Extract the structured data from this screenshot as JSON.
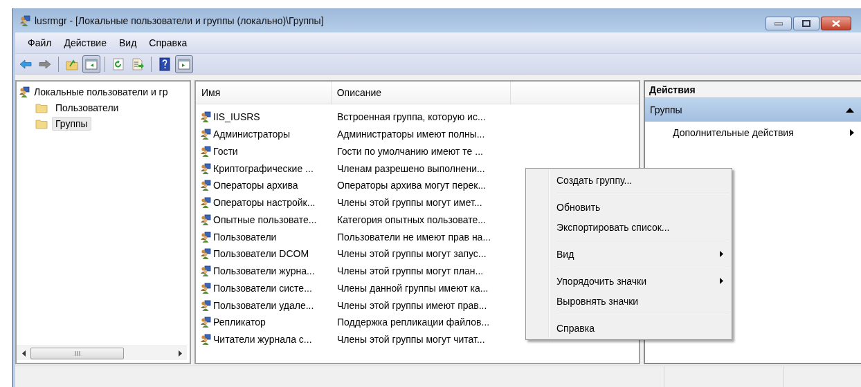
{
  "window": {
    "title": "lusrmgr - [Локальные пользователи и группы (локально)\\Группы]"
  },
  "menu_bar": [
    "Файл",
    "Действие",
    "Вид",
    "Справка"
  ],
  "toolbar": [
    {
      "kind": "back",
      "pressed": false
    },
    {
      "kind": "forward",
      "pressed": false
    },
    {
      "kind": "separator"
    },
    {
      "kind": "up",
      "pressed": false
    },
    {
      "kind": "tree-toggle",
      "pressed": true
    },
    {
      "kind": "separator"
    },
    {
      "kind": "refresh",
      "pressed": false
    },
    {
      "kind": "export",
      "pressed": false
    },
    {
      "kind": "separator"
    },
    {
      "kind": "help",
      "pressed": false
    },
    {
      "kind": "action-toggle",
      "pressed": true
    }
  ],
  "tree": {
    "label": "Локальные пользователи и гр",
    "children": [
      {
        "label": "Пользователи",
        "selected": false
      },
      {
        "label": "Группы",
        "selected": true
      }
    ]
  },
  "table": {
    "columns": [
      "Имя",
      "Описание"
    ],
    "rows": [
      {
        "name": "IIS_IUSRS",
        "description": "Встроенная группа, которую ис..."
      },
      {
        "name": "Администраторы",
        "description": "Администраторы имеют полны..."
      },
      {
        "name": "Гости",
        "description": "Гости по умолчанию имеют те ..."
      },
      {
        "name": "Криптографические ...",
        "description": "Членам разрешено выполнени..."
      },
      {
        "name": "Операторы архива",
        "description": "Операторы архива могут перек..."
      },
      {
        "name": "Операторы настройк...",
        "description": "Члены этой группы могут имет..."
      },
      {
        "name": "Опытные пользовате...",
        "description": "Категория опытных пользовате..."
      },
      {
        "name": "Пользователи",
        "description": "Пользователи не имеют прав на..."
      },
      {
        "name": "Пользователи DCOM",
        "description": "Члены этой группы могут запус..."
      },
      {
        "name": "Пользователи журна...",
        "description": "Члены этой группы могут план..."
      },
      {
        "name": "Пользователи систе...",
        "description": "Члены данной группы имеют ка..."
      },
      {
        "name": "Пользователи удале...",
        "description": "Члены этой группы имеют прав..."
      },
      {
        "name": "Репликатор",
        "description": "Поддержка репликации файлов..."
      },
      {
        "name": "Читатели журнала с...",
        "description": "Члены этой группы могут читат..."
      }
    ]
  },
  "actions": {
    "title": "Действия",
    "sections": [
      {
        "title": "Группы",
        "expanded": true,
        "items": [
          {
            "label": "Дополнительные действия",
            "submenu": true
          }
        ]
      }
    ]
  },
  "context_menu": [
    {
      "kind": "item",
      "label": "Создать группу...",
      "submenu": false
    },
    {
      "kind": "separator"
    },
    {
      "kind": "item",
      "label": "Обновить",
      "submenu": false
    },
    {
      "kind": "item",
      "label": "Экспортировать список...",
      "submenu": false
    },
    {
      "kind": "separator"
    },
    {
      "kind": "item",
      "label": "Вид",
      "submenu": true
    },
    {
      "kind": "separator"
    },
    {
      "kind": "item",
      "label": "Упорядочить значки",
      "submenu": true
    },
    {
      "kind": "item",
      "label": "Выровнять значки",
      "submenu": false
    },
    {
      "kind": "separator"
    },
    {
      "kind": "item",
      "label": "Справка",
      "submenu": false
    }
  ]
}
